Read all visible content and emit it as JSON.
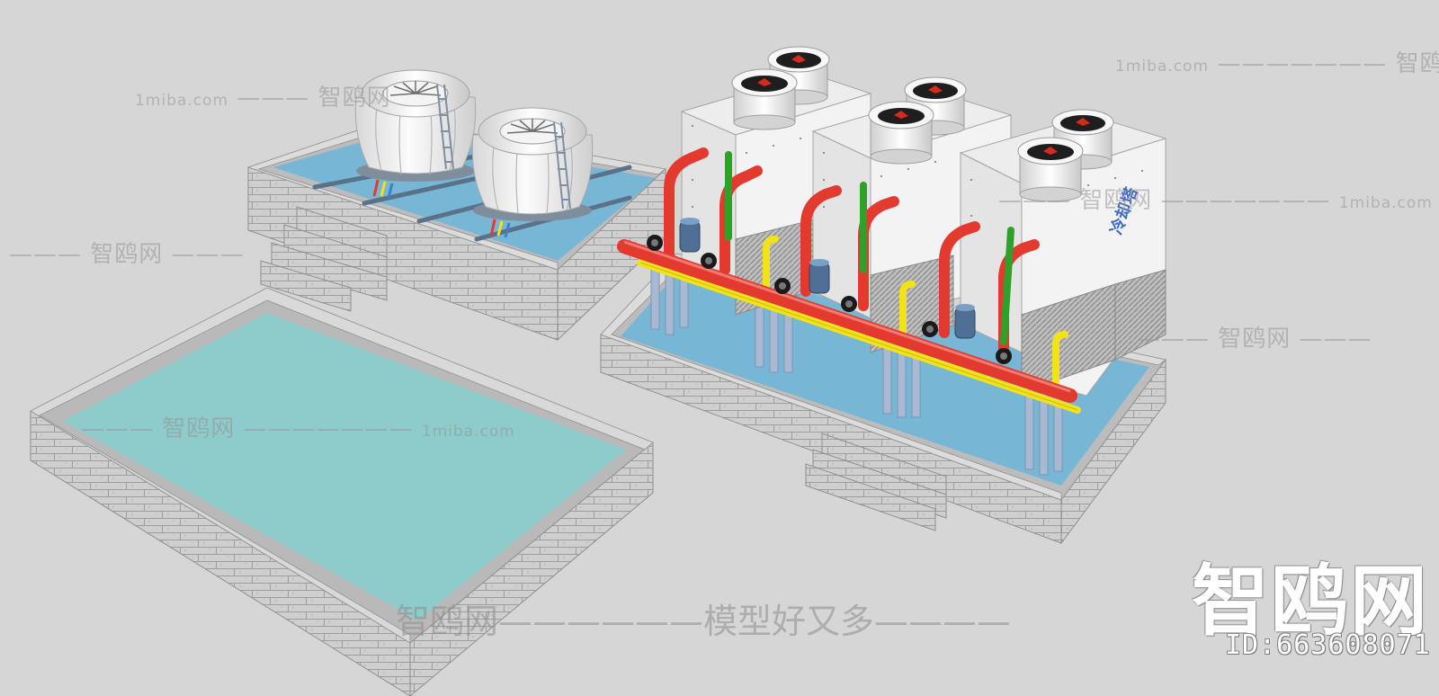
{
  "watermarks": {
    "site_cn": "智鸥网",
    "site_domain": "1miba.com",
    "dash_long": "———————",
    "dash_short": "———",
    "center_slogan": "智鸥网——————模型好又多————",
    "corner_logo": "智鸥网",
    "corner_id": "ID:663608071",
    "unit_label": "冷却塔"
  },
  "colors": {
    "background": "#d6d6d6",
    "water_main": "#8ecbcb",
    "water_basin": "#78b6d6",
    "brick": "#c9c9c9",
    "pipe_supply": "#e23a2f",
    "pipe_return": "#f2e21a",
    "pipe_green": "#2fa12a",
    "tower_body": "#e9e9e9"
  }
}
